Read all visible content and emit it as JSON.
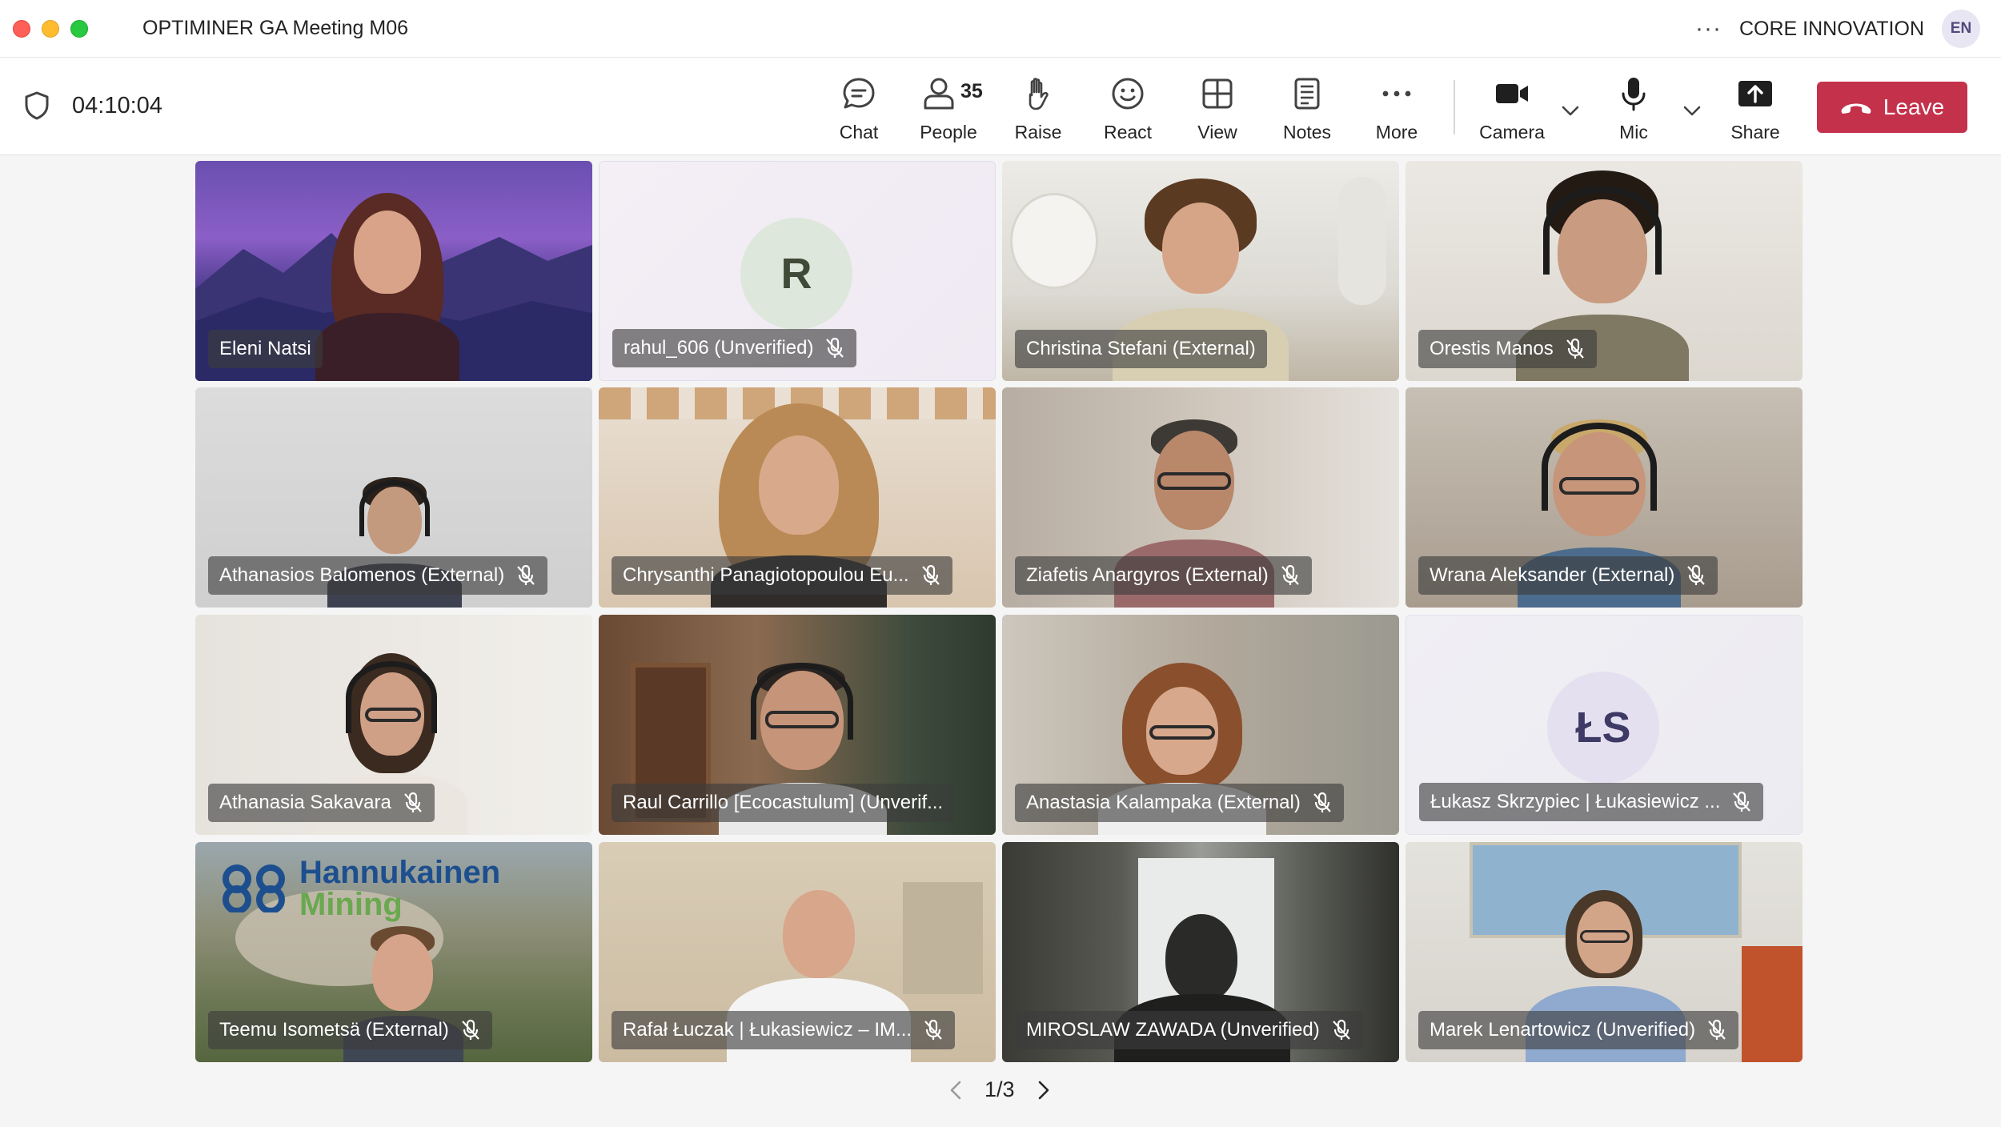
{
  "window": {
    "title": "OPTIMINER GA Meeting M06",
    "org": "CORE INNOVATION",
    "lang_avatar": "EN",
    "more": "···"
  },
  "toolbar": {
    "timer": "04:10:04",
    "chat": "Chat",
    "people": "People",
    "people_count": "35",
    "raise": "Raise",
    "react": "React",
    "view": "View",
    "notes": "Notes",
    "more": "More",
    "camera": "Camera",
    "mic": "Mic",
    "share": "Share",
    "leave": "Leave"
  },
  "participants": [
    {
      "name": "Eleni Natsi",
      "muted": false
    },
    {
      "name": "rahul_606 (Unverified)",
      "muted": true,
      "initials": "R"
    },
    {
      "name": "Christina Stefani (External)",
      "muted": false
    },
    {
      "name": "Orestis Manos",
      "muted": true
    },
    {
      "name": "Athanasios Balomenos (External)",
      "muted": true
    },
    {
      "name": "Chrysanthi Panagiotopoulou Eu...",
      "muted": true
    },
    {
      "name": "Ziafetis Anargyros (External)",
      "muted": true
    },
    {
      "name": "Wrana Aleksander (External)",
      "muted": true
    },
    {
      "name": "Athanasia Sakavara",
      "muted": true
    },
    {
      "name": "Raul Carrillo [Ecocastulum] (Unverif...",
      "muted": false
    },
    {
      "name": "Anastasia Kalampaka (External)",
      "muted": true
    },
    {
      "name": "Łukasz Skrzypiec | Łukasiewicz ...",
      "muted": true,
      "initials": "ŁS"
    },
    {
      "name": "Teemu Isometsä (External)",
      "muted": true,
      "logo_line1": "Hannukainen",
      "logo_line2": "Mining"
    },
    {
      "name": "Rafał Łuczak | Łukasiewicz – IM...",
      "muted": true
    },
    {
      "name": "MIROSLAW ZAWADA (Unverified)",
      "muted": true
    },
    {
      "name": "Marek Lenartowicz (Unverified)",
      "muted": true
    }
  ],
  "pager": {
    "label": "1/3"
  },
  "colors": {
    "leave": "#c4314b",
    "stage_bg": "#f5f5f5",
    "pill_bg": "#3c3c3c"
  }
}
